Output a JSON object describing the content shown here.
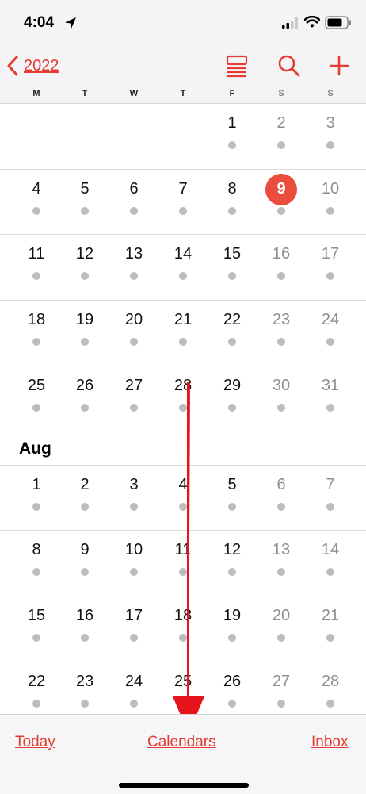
{
  "status_bar": {
    "time": "4:04",
    "icons": [
      "location-arrow-icon",
      "cellular-signal-icon",
      "wifi-icon",
      "battery-icon"
    ]
  },
  "nav": {
    "back_label": "2022",
    "back_icon": "chevron-left-icon",
    "right_icons": [
      "list-view-icon",
      "search-icon",
      "add-icon"
    ]
  },
  "weekdays": [
    "M",
    "T",
    "W",
    "T",
    "F",
    "S",
    "S"
  ],
  "months": [
    {
      "label": "",
      "weeks": [
        [
          null,
          null,
          null,
          null,
          "1",
          "2",
          "3"
        ],
        [
          "4",
          "5",
          "6",
          "7",
          "8",
          "9",
          "10"
        ],
        [
          "11",
          "12",
          "13",
          "14",
          "15",
          "16",
          "17"
        ],
        [
          "18",
          "19",
          "20",
          "21",
          "22",
          "23",
          "24"
        ],
        [
          "25",
          "26",
          "27",
          "28",
          "29",
          "30",
          "31"
        ]
      ]
    },
    {
      "label": "Aug",
      "weeks": [
        [
          "1",
          "2",
          "3",
          "4",
          "5",
          "6",
          "7"
        ],
        [
          "8",
          "9",
          "10",
          "11",
          "12",
          "13",
          "14"
        ],
        [
          "15",
          "16",
          "17",
          "18",
          "19",
          "20",
          "21"
        ],
        [
          "22",
          "23",
          "24",
          "25",
          "26",
          "27",
          "28"
        ]
      ]
    }
  ],
  "today": "9",
  "colors": {
    "accent": "#e53b30",
    "today_circle": "#eb4d3d",
    "weekend_text": "#8e8e93",
    "event_dot": "#bdbdc0",
    "annotation_arrow": "#e8141c"
  },
  "tab_bar": {
    "today_label": "Today",
    "calendars_label": "Calendars",
    "inbox_label": "Inbox"
  }
}
